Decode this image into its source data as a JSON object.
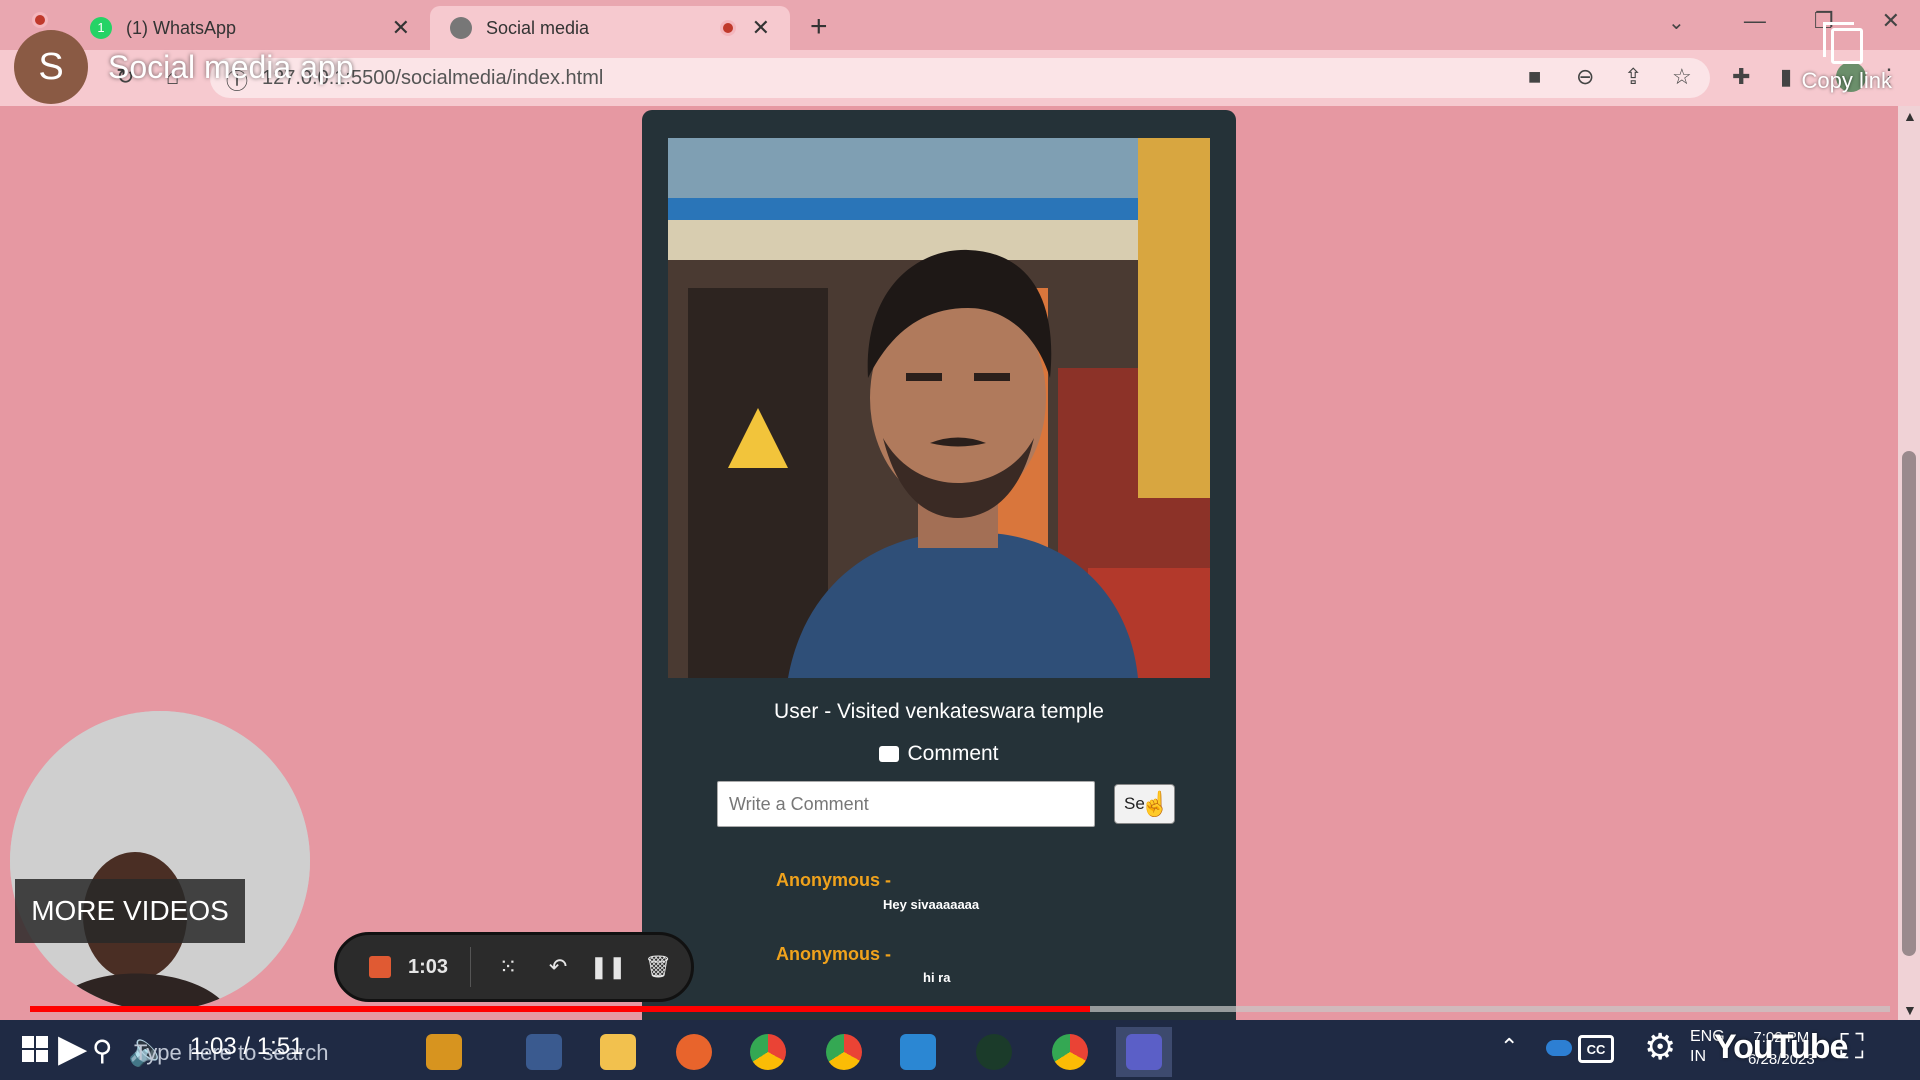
{
  "browser": {
    "tabs": [
      {
        "label": "(1) WhatsApp",
        "badge": "1"
      },
      {
        "label": "Social media"
      }
    ],
    "url": "127.0.0.1:5500/socialmedia/index.html"
  },
  "video_overlay": {
    "channel_initial": "S",
    "title": "Social media app",
    "copy_link_label": "Copy link",
    "more_videos_label": "MORE VIDEOS",
    "time": "1:03 / 1:51",
    "progress": 0.57,
    "logo": "YouTube",
    "cc_label": "CC"
  },
  "recorder": {
    "elapsed": "1:03"
  },
  "post": {
    "caption": "User - Visited venkateswara temple",
    "comment_heading": "Comment",
    "comment_placeholder": "Write a Comment",
    "send_label": "Se",
    "comments": [
      {
        "author": "Anonymous -",
        "text": "Hey sivaaaaaaa"
      },
      {
        "author": "Anonymous -",
        "text": "hi ra"
      }
    ]
  },
  "taskbar": {
    "search_text": "Type here to search",
    "lang_1": "ENG",
    "lang_2": "IN",
    "clock_time": "7:02 PM",
    "clock_date": "6/28/2023"
  },
  "colors": {
    "page_bg": "#e698a2",
    "card_bg": "#253238",
    "author": "#f0a21c",
    "progress": "#ff0000",
    "taskbar": "#1f2a44"
  }
}
